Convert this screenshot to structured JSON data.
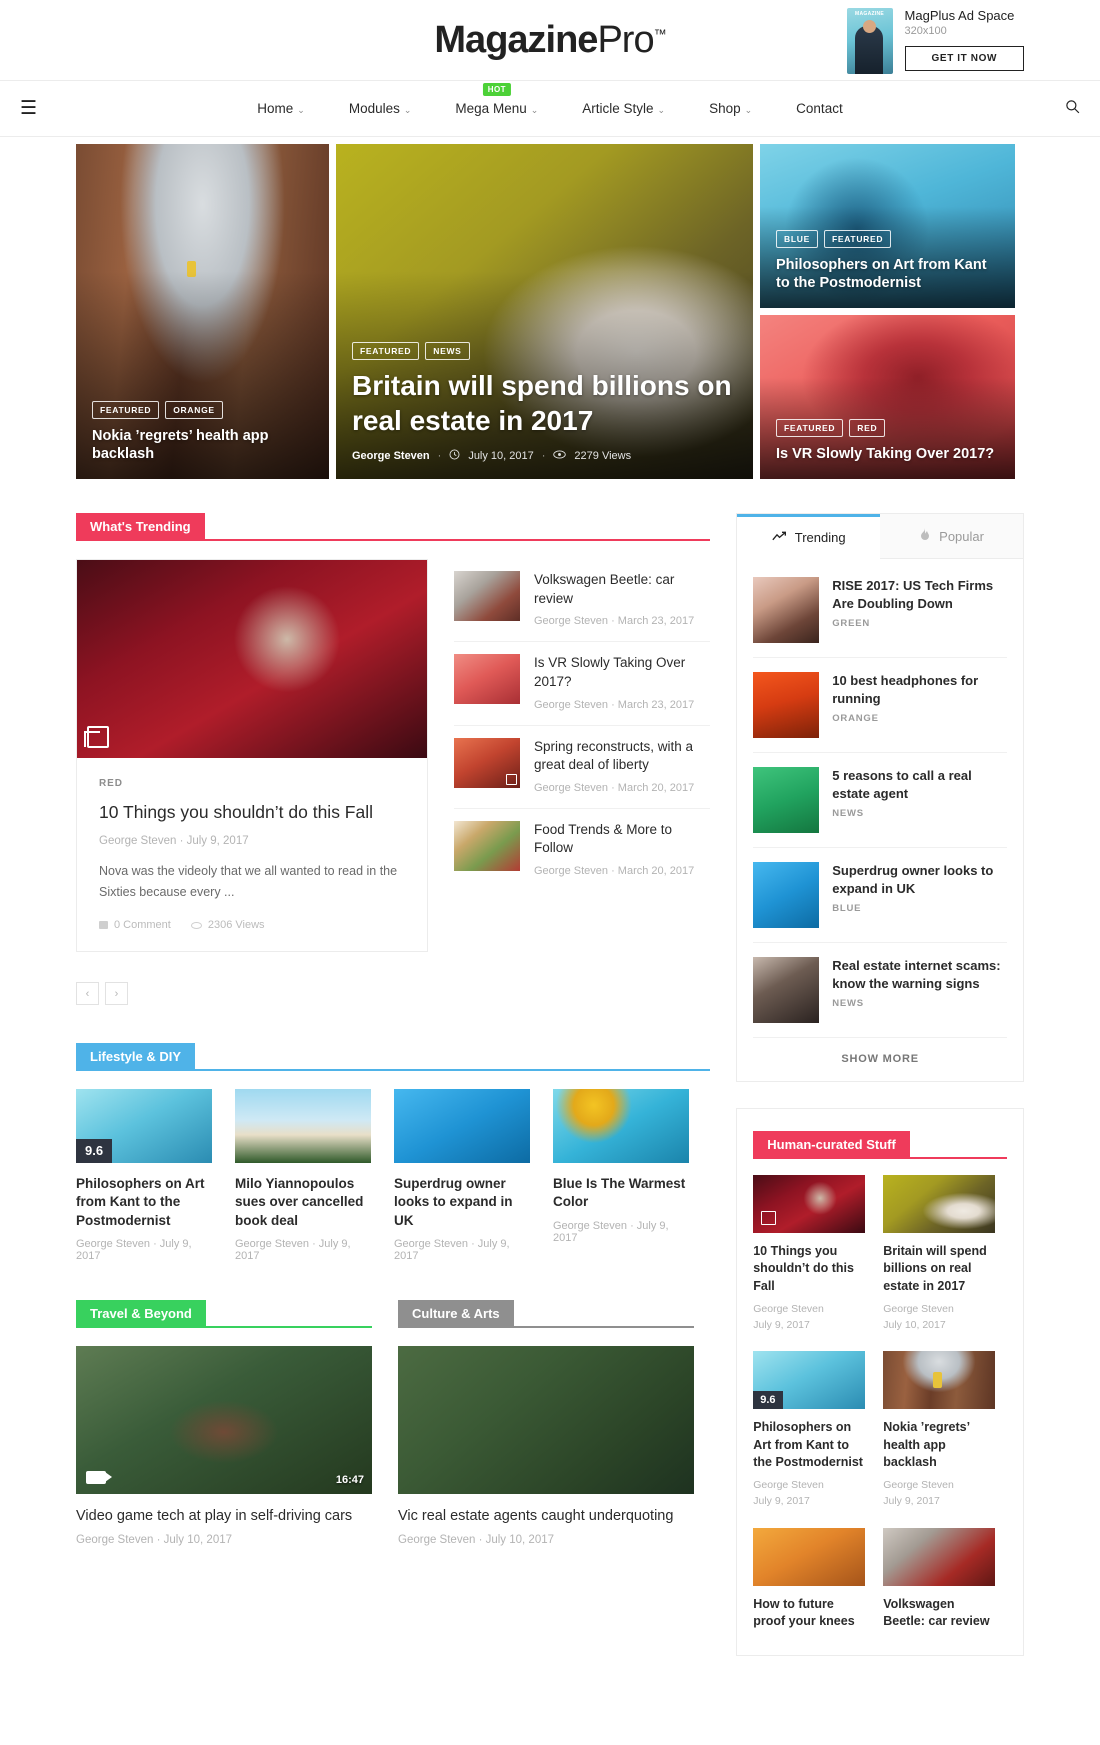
{
  "header": {
    "brand_bold": "Magazine",
    "brand_light": "Pro",
    "brand_tm": "™",
    "ad": {
      "thumb_label": "MAGAZINE",
      "title": "MagPlus Ad Space",
      "size": "320x100",
      "cta": "GET IT NOW"
    }
  },
  "nav": {
    "hamburger": "☰",
    "search_icon": "search-icon",
    "items": [
      {
        "label": "Home",
        "caret": "⌄",
        "badge": ""
      },
      {
        "label": "Modules",
        "caret": "⌄",
        "badge": ""
      },
      {
        "label": "Mega Menu",
        "caret": "⌄",
        "badge": "HOT"
      },
      {
        "label": "Article Style",
        "caret": "⌄",
        "badge": ""
      },
      {
        "label": "Shop",
        "caret": "⌄",
        "badge": ""
      },
      {
        "label": "Contact",
        "caret": "",
        "badge": ""
      }
    ]
  },
  "hero": {
    "left": {
      "badges": [
        "FEATURED",
        "ORANGE"
      ],
      "title": "Nokia ’regrets’ health app backlash"
    },
    "center": {
      "badges": [
        "FEATURED",
        "NEWS"
      ],
      "title": "Britain will spend billions on real estate in 2017",
      "author": "George Steven",
      "date": "July 10, 2017",
      "views": "2279 Views"
    },
    "right_top": {
      "badges": [
        "BLUE",
        "FEATURED"
      ],
      "title": "Philosophers on Art from Kant to the Postmodernist"
    },
    "right_bottom": {
      "badges": [
        "FEATURED",
        "RED"
      ],
      "title": "Is VR Slowly Taking Over 2017?"
    }
  },
  "trending_section": {
    "heading": "What's Trending",
    "accent": "#ef3b5b",
    "feature": {
      "kicker": "RED",
      "title": "10 Things you shouldn’t do this Fall",
      "author": "George Steven",
      "date": "July 9, 2017",
      "excerpt": "Nova was the videoly that we all wanted to read in the Sixties because every ...",
      "comments": "0 Comment",
      "views": "2306 Views"
    },
    "list": [
      {
        "title": "Volkswagen Beetle: car review",
        "author": "George Steven",
        "date": "March 23, 2017",
        "thumb": "im-car"
      },
      {
        "title": "Is VR Slowly Taking Over 2017?",
        "author": "George Steven",
        "date": "March 23, 2017",
        "thumb": "im-vr2"
      },
      {
        "title": "Spring reconstructs, with a great deal of liberty",
        "author": "George Steven",
        "date": "March 20, 2017",
        "thumb": "im-spring"
      },
      {
        "title": "Food Trends & More to Follow",
        "author": "George Steven",
        "date": "March 20, 2017",
        "thumb": "im-food"
      }
    ],
    "pager": {
      "prev": "‹",
      "next": "›"
    }
  },
  "sidebar_widget": {
    "tabs": [
      {
        "label": "Trending",
        "icon": "trending-up-icon",
        "glyph": "📈",
        "active": true
      },
      {
        "label": "Popular",
        "icon": "fire-icon",
        "glyph": "🔥",
        "active": false
      }
    ],
    "items": [
      {
        "title": "RISE 2017: US Tech Firms Are Doubling Down",
        "category": "GREEN",
        "thumb": "im-bubble"
      },
      {
        "title": "10 best headphones for running",
        "category": "ORANGE",
        "thumb": "im-torii"
      },
      {
        "title": "5 reasons to call a real estate agent",
        "category": "NEWS",
        "thumb": "im-tennis"
      },
      {
        "title": "Superdrug owner looks to expand in UK",
        "category": "BLUE",
        "thumb": "im-bluedoor"
      },
      {
        "title": "Real estate internet scams: know the warning signs",
        "category": "NEWS",
        "thumb": "im-portrait"
      }
    ],
    "show_more": "SHOW MORE"
  },
  "lifestyle_section": {
    "heading": "Lifestyle & DIY",
    "accent": "#4fb3e8",
    "items": [
      {
        "title": "Philosophers on Art from Kant to the Postmodernist",
        "author": "George Steven",
        "date": "July 9, 2017",
        "rating": "9.6",
        "thumb": "im-pool"
      },
      {
        "title": "Milo Yiannopoulos sues over cancelled book deal",
        "author": "George Steven",
        "date": "July 9, 2017",
        "rating": "",
        "thumb": "im-palms"
      },
      {
        "title": "Superdrug owner looks to expand in UK",
        "author": "George Steven",
        "date": "July 9, 2017",
        "rating": "",
        "thumb": "im-bluedoor"
      },
      {
        "title": "Blue Is The Warmest Color",
        "author": "George Steven",
        "date": "July 9, 2017",
        "rating": "",
        "thumb": "im-floatie"
      }
    ]
  },
  "travel_section": {
    "heading": "Travel & Beyond",
    "accent": "#38d15e",
    "item": {
      "title": "Video game tech at play in self-driving cars",
      "author": "George Steven",
      "date": "July 10, 2017",
      "duration": "16:47",
      "thumb": "im-forest"
    }
  },
  "culture_section": {
    "heading": "Culture & Arts",
    "accent": "#8f8f8f",
    "item": {
      "title": "Vic real estate agents caught underquoting",
      "author": "George Steven",
      "date": "July 10, 2017",
      "duration": "",
      "thumb": "im-road"
    }
  },
  "curated_widget": {
    "heading": "Human-curated Stuff",
    "accent": "#ef3b5b",
    "items": [
      {
        "title": "10 Things you shouldn’t do this Fall",
        "author": "George Steven",
        "date": "July 9, 2017",
        "thumb": "im-roses",
        "gallery": true,
        "rating": ""
      },
      {
        "title": "Britain will spend billions on real estate in 2017",
        "author": "George Steven",
        "date": "July 10, 2017",
        "thumb": "im-chair",
        "gallery": false,
        "rating": ""
      },
      {
        "title": "Philosophers on Art from Kant to the Postmodernist",
        "author": "George Steven",
        "date": "July 9, 2017",
        "thumb": "im-pool",
        "gallery": false,
        "rating": "9.6"
      },
      {
        "title": "Nokia ’regrets’ health app backlash",
        "author": "George Steven",
        "date": "July 9, 2017",
        "thumb": "im-canyon",
        "gallery": false,
        "rating": ""
      },
      {
        "title": "How to future proof your knees",
        "author": "",
        "date": "",
        "thumb": "im-mic",
        "gallery": false,
        "rating": ""
      },
      {
        "title": "Volkswagen Beetle: car review",
        "author": "",
        "date": "",
        "thumb": "im-redcar",
        "gallery": false,
        "rating": ""
      }
    ]
  }
}
